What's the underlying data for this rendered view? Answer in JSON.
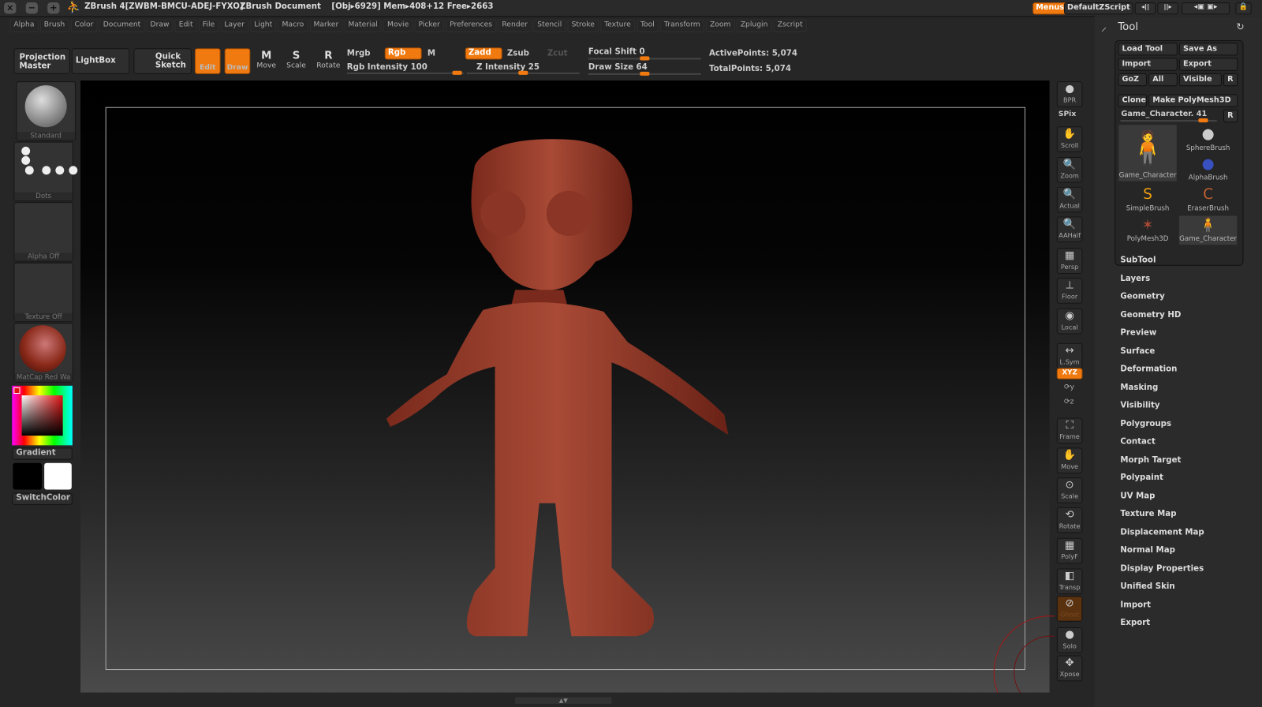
{
  "titlebar": {
    "app": "ZBrush 4[ZWBM-BMCU-ADEJ-FYXO]",
    "document": "ZBrush Document",
    "stats": "[Obj▸6929] Mem▸408+12 Free▸2663",
    "menus_btn": "Menus",
    "script": "DefaultZScript"
  },
  "menus": [
    "Alpha",
    "Brush",
    "Color",
    "Document",
    "Draw",
    "Edit",
    "File",
    "Layer",
    "Light",
    "Macro",
    "Marker",
    "Material",
    "Movie",
    "Picker",
    "Preferences",
    "Render",
    "Stencil",
    "Stroke",
    "Texture",
    "Tool",
    "Transform",
    "Zoom",
    "Zplugin",
    "Zscript"
  ],
  "toolbar": {
    "projection_master": "Projection Master",
    "lightbox": "LightBox",
    "quick_sketch": "Quick Sketch",
    "edit": "Edit",
    "draw": "Draw",
    "move": "Move",
    "scale": "Scale",
    "rotate": "Rotate",
    "mrgb": "Mrgb",
    "rgb": "Rgb",
    "m": "M",
    "zadd": "Zadd",
    "zsub": "Zsub",
    "zcut": "Zcut",
    "rgb_intensity": "Rgb Intensity 100",
    "z_intensity": "Z Intensity 25",
    "focal_shift": "Focal Shift 0",
    "draw_size": "Draw Size 64",
    "active_points": "ActivePoints: 5,074",
    "total_points": "TotalPoints: 5,074",
    "rgb_intensity_value": 100,
    "z_intensity_value": 25,
    "focal_shift_value": 0,
    "draw_size_value": 64
  },
  "left": {
    "brush": "Standard",
    "stroke": "Dots",
    "alpha": "Alpha Off",
    "texture": "Texture Off",
    "material": "MatCap Red Wa",
    "gradient": "Gradient",
    "switch_color": "SwitchColor",
    "color_main": "#e01010"
  },
  "right_shelf": [
    "BPR",
    "SPix",
    "Scroll",
    "Zoom",
    "Actual",
    "AAHalf",
    "Persp",
    "Floor",
    "Local",
    "L.Sym",
    "XYZ",
    "Frame",
    "Move",
    "Scale",
    "Rotate",
    "PolyF",
    "Transp",
    "Ghost",
    "Solo",
    "Xpose"
  ],
  "tool": {
    "title": "Tool",
    "load_tool": "Load Tool",
    "save_as": "Save As",
    "import": "Import",
    "export": "Export",
    "goz": "GoZ",
    "all": "All",
    "visible": "Visible",
    "r": "R",
    "clone": "Clone",
    "make_polymesh": "Make PolyMesh3D",
    "current": "Game_Character. 41",
    "tools": [
      "Game_Character",
      "SphereBrush",
      "AlphaBrush",
      "SimpleBrush",
      "EraserBrush",
      "PolyMesh3D",
      "Game_Character"
    ],
    "subpalettes": [
      "SubTool",
      "Layers",
      "Geometry",
      "Geometry HD",
      "Preview",
      "Surface",
      "Deformation",
      "Masking",
      "Visibility",
      "Polygroups",
      "Contact",
      "Morph Target",
      "Polypaint",
      "UV Map",
      "Texture Map",
      "Displacement Map",
      "Normal Map",
      "Display Properties",
      "Unified Skin",
      "Import",
      "Export"
    ]
  }
}
